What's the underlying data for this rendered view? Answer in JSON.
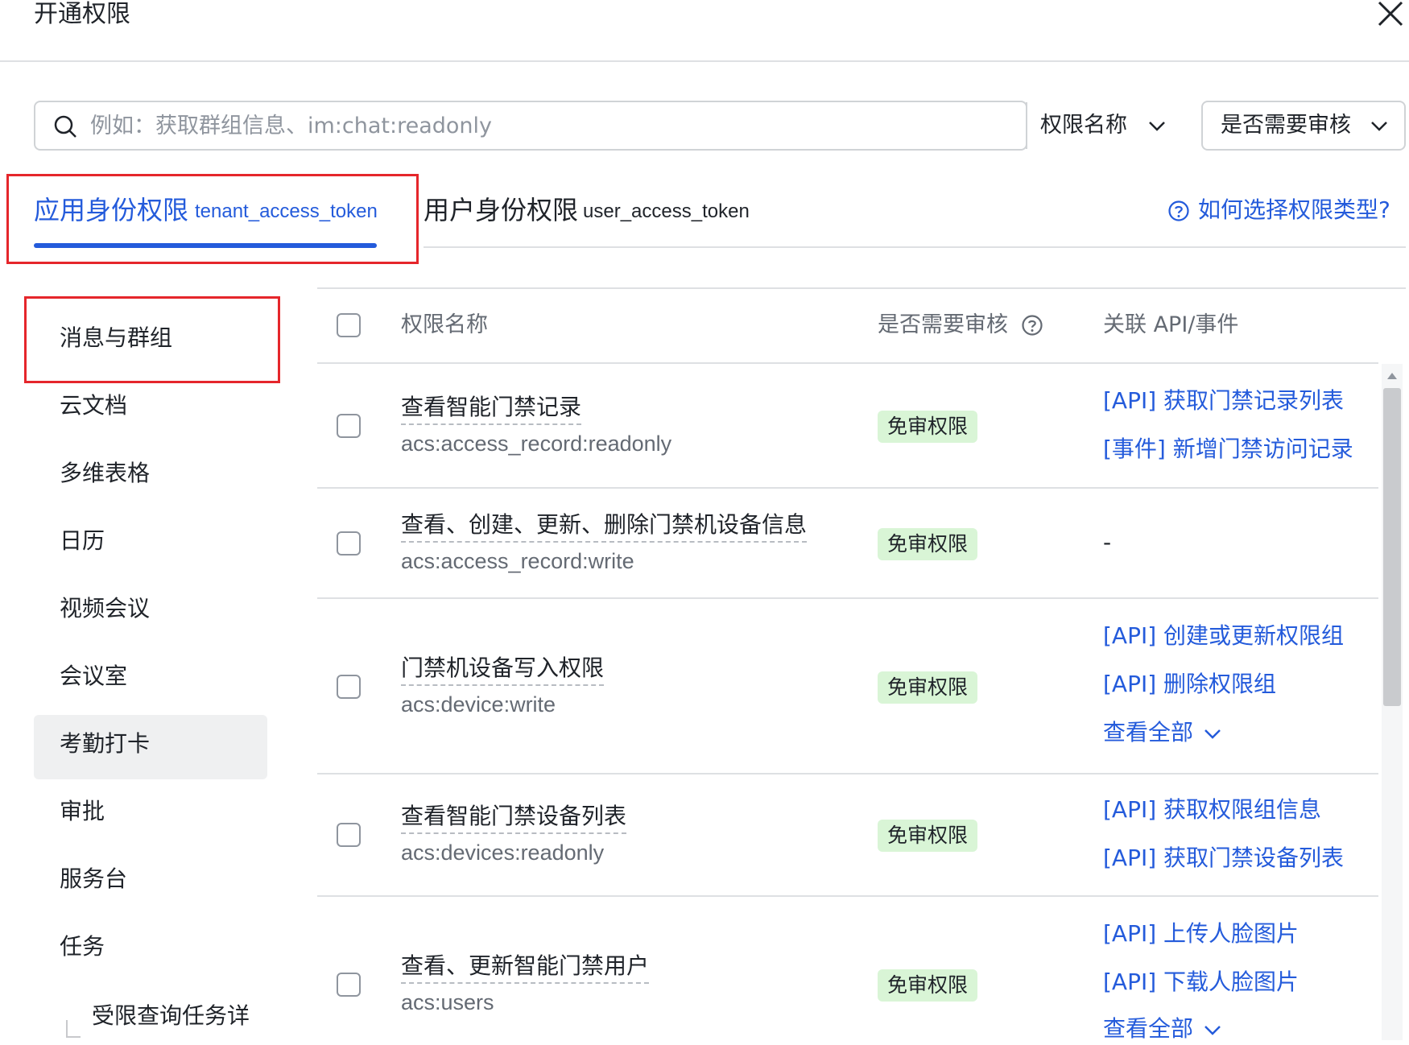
{
  "dialog": {
    "title": "开通权限"
  },
  "search": {
    "placeholder": "例如：获取群组信息、im:chat:readonly",
    "filter1": "权限名称",
    "filter2": "是否需要审核"
  },
  "tabs": [
    {
      "label": "应用身份权限",
      "token": "tenant_access_token",
      "active": true
    },
    {
      "label": "用户身份权限",
      "token": "user_access_token",
      "active": false
    }
  ],
  "help_link": "如何选择权限类型?",
  "sidebar": {
    "items": [
      {
        "label": "消息与群组"
      },
      {
        "label": "云文档"
      },
      {
        "label": "多维表格"
      },
      {
        "label": "日历"
      },
      {
        "label": "视频会议"
      },
      {
        "label": "会议室"
      },
      {
        "label": "考勤打卡",
        "active": true
      },
      {
        "label": "审批"
      },
      {
        "label": "服务台"
      },
      {
        "label": "任务"
      },
      {
        "label": "受限查询任务详"
      }
    ]
  },
  "table": {
    "headers": {
      "name": "权限名称",
      "review": "是否需要审核",
      "api": "关联 API/事件"
    },
    "rows": [
      {
        "name": "查看智能门禁记录",
        "code": "acs:access_record:readonly",
        "review": "免审权限",
        "links": [
          "[API] 获取门禁记录列表",
          "[事件] 新增门禁访问记录"
        ]
      },
      {
        "name": "查看、创建、更新、删除门禁机设备信息",
        "code": "acs:access_record:write",
        "review": "免审权限",
        "no_link": "-"
      },
      {
        "name": "门禁机设备写入权限",
        "code": "acs:device:write",
        "review": "免审权限",
        "links": [
          "[API] 创建或更新权限组",
          "[API] 删除权限组"
        ],
        "more": "查看全部"
      },
      {
        "name": "查看智能门禁设备列表",
        "code": "acs:devices:readonly",
        "review": "免审权限",
        "links": [
          "[API] 获取权限组信息",
          "[API] 获取门禁设备列表"
        ]
      },
      {
        "name": "查看、更新智能门禁用户",
        "code": "acs:users",
        "review": "免审权限",
        "links": [
          "[API] 上传人脸图片",
          "[API] 下载人脸图片"
        ],
        "more": "查看全部"
      }
    ]
  },
  "colors": {
    "accent": "#245bdb",
    "badge_bg": "#d9f5d6",
    "highlight_border": "#e5262b"
  }
}
